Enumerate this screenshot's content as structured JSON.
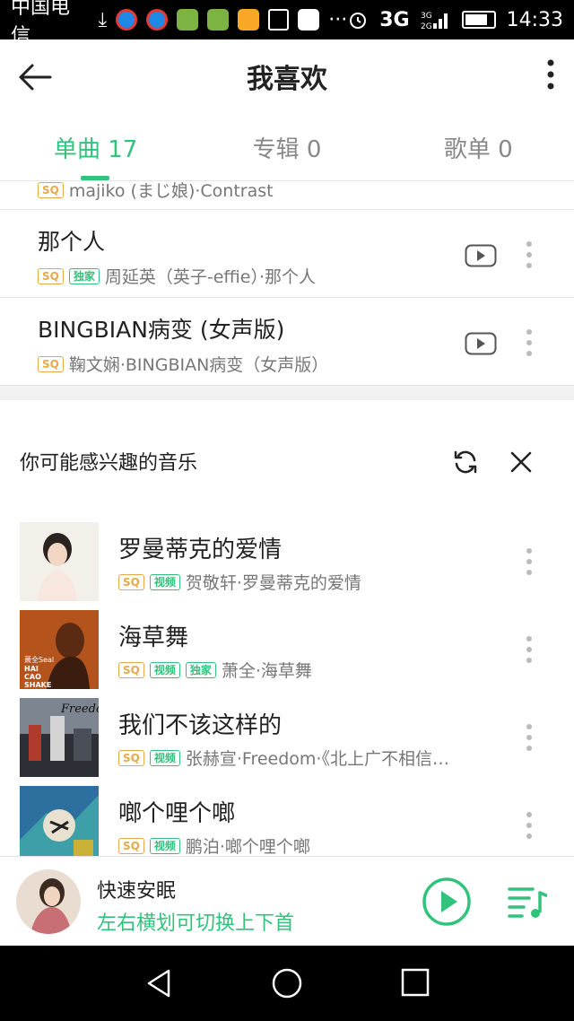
{
  "status_bar": {
    "carrier": "中国电信",
    "download_glyph": "⤓",
    "network_primary": "3G",
    "network_secondary": "3G\n2G",
    "time": "14:33",
    "ellipsis": "···"
  },
  "header": {
    "title": "我喜欢"
  },
  "tabs": [
    {
      "label": "单曲 17",
      "active": true
    },
    {
      "label": "专辑 0",
      "active": false
    },
    {
      "label": "歌单 0",
      "active": false
    }
  ],
  "tags": {
    "sq": "SQ",
    "exclusive": "独家",
    "video": "视频"
  },
  "liked_songs": {
    "partial_row_subtitle": "majiko (まじ娘)·Contrast",
    "rows": [
      {
        "title": "那个人",
        "subtitle": "周延英（英子-effie）·那个人"
      },
      {
        "title": "BINGBIAN病变 (女声版)",
        "subtitle": "鞠文娴·BINGBIAN病变（女声版）"
      }
    ]
  },
  "recommendations": {
    "title": "你可能感兴趣的音乐",
    "items": [
      {
        "title": "罗曼蒂克的爱情",
        "subtitle": "贺敬轩·罗曼蒂克的爱情"
      },
      {
        "title": "海草舞",
        "subtitle": "萧全·海草舞",
        "cover_text": "萧全Seal\nHAI\nCAO\nSHAKE"
      },
      {
        "title": "我们不该这样的",
        "subtitle": "张赫宣·Freedom·《北上广不相信…",
        "cover_text": "Freedom"
      },
      {
        "title": "啷个哩个啷",
        "subtitle": "鹏泊·啷个哩个啷"
      }
    ]
  },
  "player": {
    "title": "快速安眠",
    "hint": "左右横划可切换上下首"
  },
  "colors": {
    "accent": "#31c27c",
    "sq_tag": "#e8a94a"
  }
}
